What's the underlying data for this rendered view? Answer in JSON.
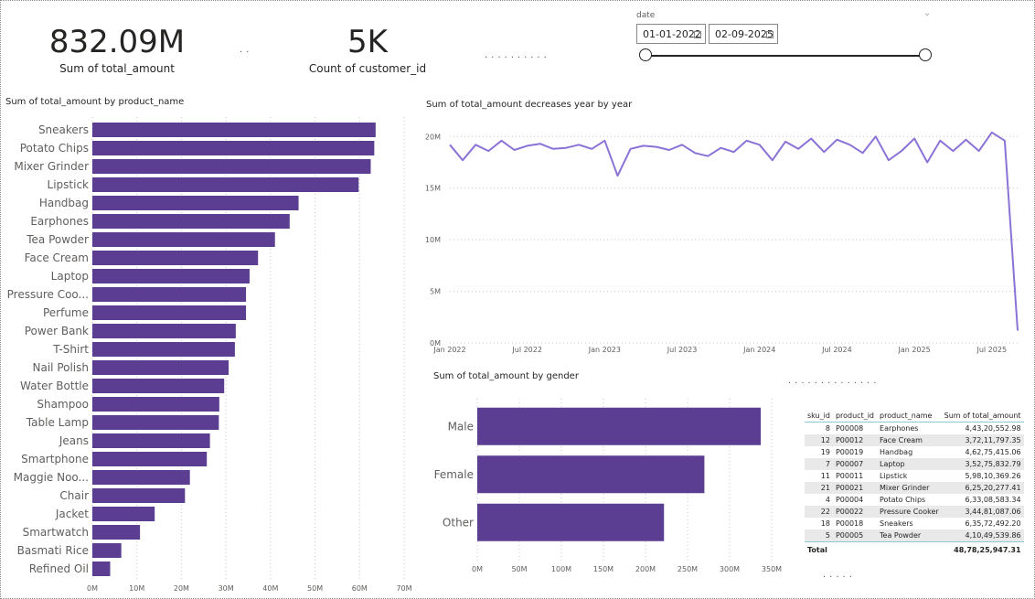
{
  "kpis": [
    {
      "value": "832.09M",
      "label": "Sum of total_amount"
    },
    {
      "value": "5K",
      "label": "Count of customer_id"
    }
  ],
  "slicer": {
    "title": "date",
    "start": "01-01-2022",
    "end": "02-09-2025",
    "start_fraction": 0,
    "end_fraction": 1
  },
  "colors": {
    "bar": "#5b3d91",
    "line": "#8b72d6",
    "grid": "#c8c6c4"
  },
  "chart_data": [
    {
      "type": "bar",
      "orientation": "horizontal",
      "title": "Sum of total_amount by product_name",
      "categories": [
        "Sneakers",
        "Potato Chips",
        "Mixer Grinder",
        "Lipstick",
        "Handbag",
        "Earphones",
        "Tea Powder",
        "Face Cream",
        "Laptop",
        "Pressure Coo...",
        "Perfume",
        "Power Bank",
        "T-Shirt",
        "Nail Polish",
        "Water Bottle",
        "Shampoo",
        "Table Lamp",
        "Jeans",
        "Smartphone",
        "Maggie Noo...",
        "Chair",
        "Jacket",
        "Smartwatch",
        "Basmati Rice",
        "Refined Oil"
      ],
      "values": [
        63.6,
        63.3,
        62.5,
        59.8,
        46.3,
        44.3,
        41.0,
        37.2,
        35.3,
        34.5,
        34.5,
        32.2,
        32.0,
        30.6,
        29.6,
        28.5,
        28.4,
        26.4,
        25.7,
        21.9,
        20.8,
        14.0,
        10.7,
        6.5,
        4.0
      ],
      "unit": "M",
      "xlim": [
        0,
        70
      ],
      "xticks": [
        "0M",
        "10M",
        "20M",
        "30M",
        "40M",
        "50M",
        "60M",
        "70M"
      ],
      "grid": true
    },
    {
      "type": "line",
      "title": "Sum of total_amount decreases year by year",
      "x_range": [
        "2022-01",
        "2025-09"
      ],
      "y": [
        19.2,
        17.7,
        19.2,
        18.6,
        19.6,
        18.7,
        19.1,
        19.3,
        18.8,
        18.9,
        19.2,
        18.8,
        19.6,
        16.2,
        18.8,
        19.1,
        19.0,
        18.7,
        19.2,
        18.4,
        18.1,
        18.9,
        18.5,
        19.6,
        19.2,
        17.7,
        19.5,
        18.8,
        19.8,
        18.5,
        19.7,
        19.2,
        18.4,
        20.0,
        17.7,
        18.6,
        19.8,
        17.5,
        19.6,
        18.6,
        19.7,
        18.6,
        20.4,
        19.6,
        1.2
      ],
      "unit": "M",
      "ylim": [
        0,
        21
      ],
      "yticks": [
        "0M",
        "5M",
        "10M",
        "15M",
        "20M"
      ],
      "xticks": [
        "Jan 2022",
        "Jul 2022",
        "Jan 2023",
        "Jul 2023",
        "Jan 2024",
        "Jul 2024",
        "Jan 2025",
        "Jul 2025"
      ],
      "grid": true
    },
    {
      "type": "bar",
      "orientation": "horizontal",
      "title": "Sum of total_amount by gender",
      "categories": [
        "Male",
        "Female",
        "Other"
      ],
      "values": [
        337,
        270,
        222
      ],
      "unit": "M",
      "xlim": [
        0,
        350
      ],
      "xticks": [
        "0M",
        "50M",
        "100M",
        "150M",
        "200M",
        "250M",
        "300M",
        "350M"
      ],
      "grid": true
    },
    {
      "type": "table",
      "columns": [
        "sku_id",
        "product_id",
        "product_name",
        "Sum of total_amount"
      ],
      "rows": [
        [
          "8",
          "P00008",
          "Earphones",
          "4,43,20,552.98"
        ],
        [
          "12",
          "P00012",
          "Face Cream",
          "3,72,11,797.35"
        ],
        [
          "19",
          "P00019",
          "Handbag",
          "4,62,75,415.06"
        ],
        [
          "7",
          "P00007",
          "Laptop",
          "3,52,75,832.79"
        ],
        [
          "11",
          "P00011",
          "Lipstick",
          "5,98,10,369.26"
        ],
        [
          "21",
          "P00021",
          "Mixer Grinder",
          "6,25,20,277.41"
        ],
        [
          "4",
          "P00004",
          "Potato Chips",
          "6,33,08,583.34"
        ],
        [
          "22",
          "P00022",
          "Pressure Cooker",
          "3,44,81,087.06"
        ],
        [
          "18",
          "P00018",
          "Sneakers",
          "6,35,72,492.20"
        ],
        [
          "5",
          "P00005",
          "Tea Powder",
          "4,10,49,539.86"
        ]
      ],
      "total_label": "Total",
      "total_value": "48,78,25,947.31"
    }
  ]
}
